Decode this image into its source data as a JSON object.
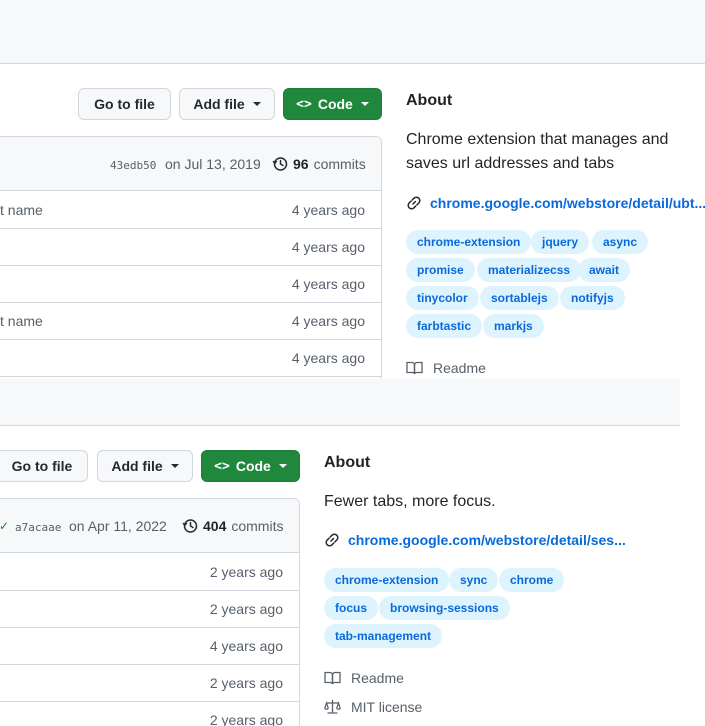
{
  "repo1": {
    "buttons": {
      "go_to_file": "Go to file",
      "add_file": "Add file",
      "code": "Code",
      "code_glyph": "<>"
    },
    "commit": {
      "hash": "43edb50",
      "date": "on Jul 13, 2019",
      "count": "96",
      "count_label": "commits"
    },
    "files": [
      {
        "message": "ct name",
        "age": "4 years ago"
      },
      {
        "message": "",
        "age": "4 years ago"
      },
      {
        "message": "",
        "age": "4 years ago"
      },
      {
        "message": "ct name",
        "age": "4 years ago"
      },
      {
        "message": "",
        "age": "4 years ago"
      }
    ],
    "about": {
      "title": "About",
      "description": "Chrome extension that manages and saves url addresses and tabs",
      "link": "chrome.google.com/webstore/detail/ubt...",
      "topics": [
        "chrome-extension",
        "jquery",
        "async",
        "promise",
        "materializecss",
        "await",
        "tinycolor",
        "sortablejs",
        "notifyjs",
        "farbtastic",
        "markjs"
      ],
      "readme": "Readme"
    }
  },
  "repo2": {
    "buttons": {
      "go_to_file": "Go to file",
      "add_file": "Add file",
      "code": "Code",
      "code_glyph": "<>"
    },
    "commit": {
      "check": "✓",
      "hash": "a7acaae",
      "date": "on Apr 11, 2022",
      "count": "404",
      "count_label": "commits"
    },
    "files": [
      {
        "age": "2 years ago"
      },
      {
        "age": "2 years ago"
      },
      {
        "age": "4 years ago"
      },
      {
        "age": "2 years ago"
      },
      {
        "age": "2 years ago"
      }
    ],
    "about": {
      "title": "About",
      "description": "Fewer tabs, more focus.",
      "link": "chrome.google.com/webstore/detail/ses...",
      "topics": [
        "chrome-extension",
        "sync",
        "chrome",
        "focus",
        "browsing-sessions",
        "tab-management"
      ],
      "readme": "Readme",
      "license": "MIT license"
    }
  },
  "colors": {
    "green": "#1f883d",
    "link_blue": "#0969da",
    "topic_bg": "#ddf4ff",
    "border": "#d0d7de",
    "muted": "#57606a"
  },
  "icons": [
    "code-icon",
    "history-icon",
    "link-icon",
    "book-icon",
    "scale-icon",
    "check-icon",
    "caret-down-icon"
  ]
}
